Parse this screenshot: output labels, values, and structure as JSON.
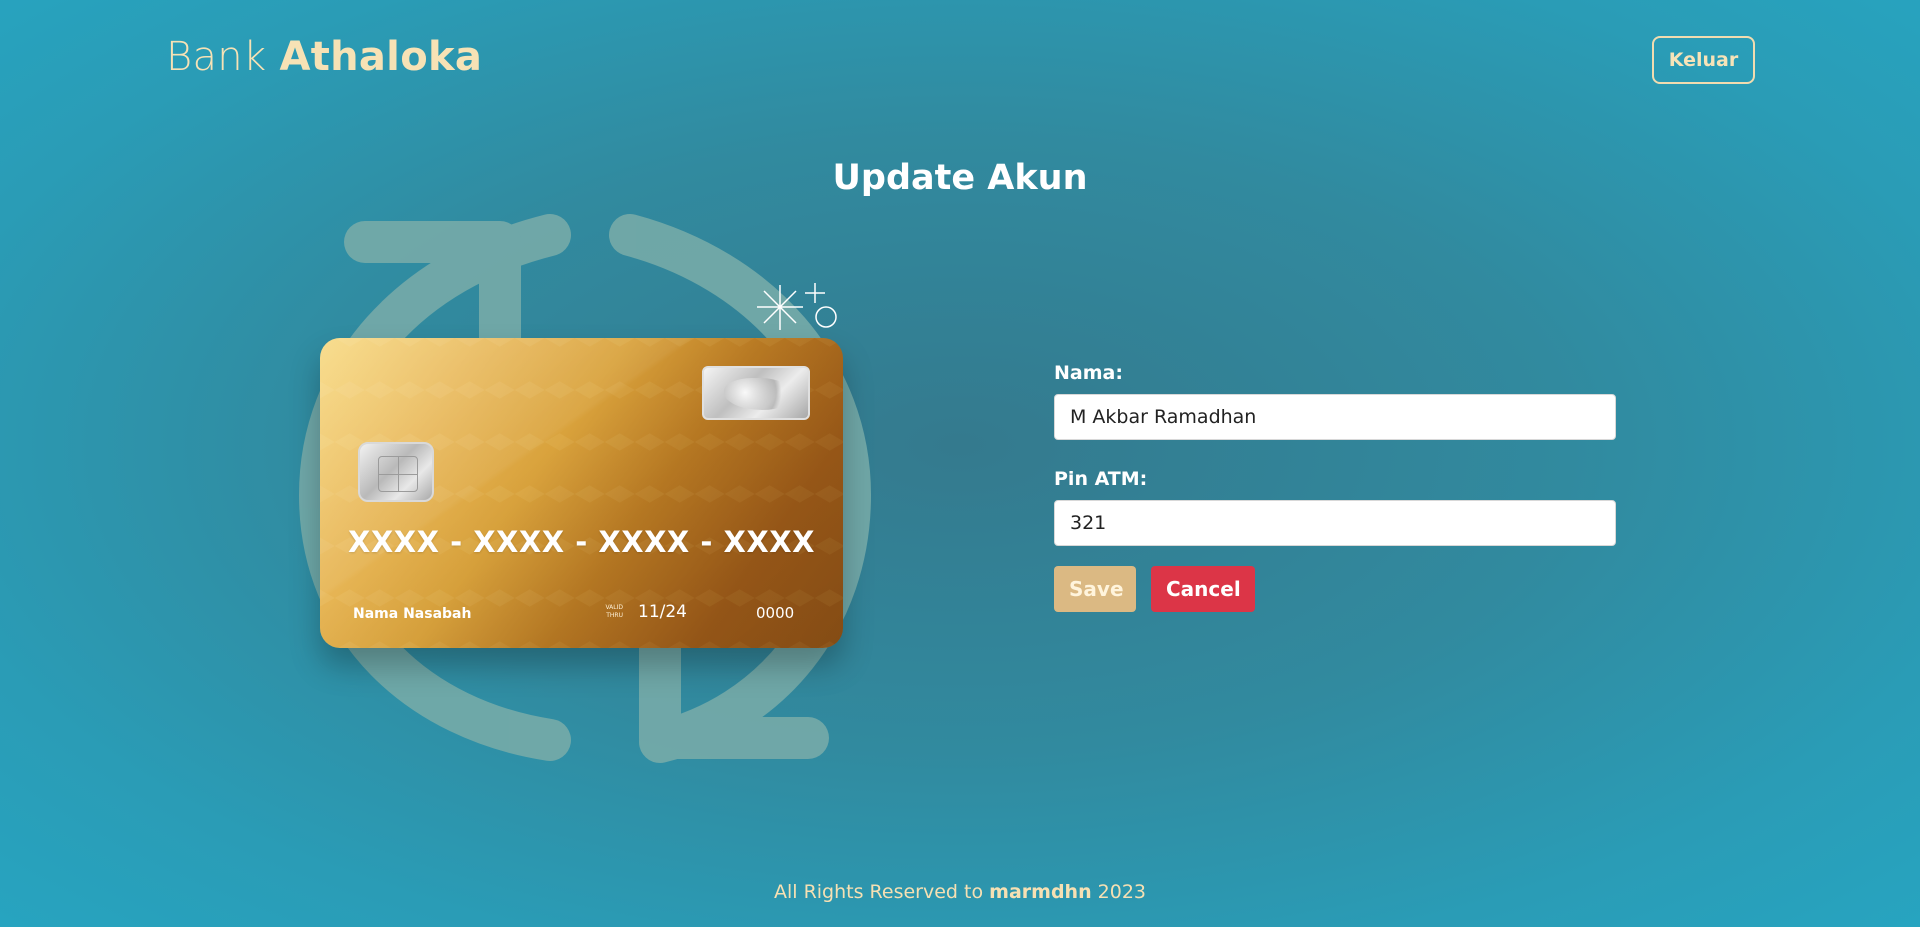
{
  "header": {
    "brand_prefix": "Bank",
    "brand_name": "Athaloka",
    "logout_label": "Keluar"
  },
  "main": {
    "title": "Update Akun",
    "card": {
      "number": "XXXX - XXXX - XXXX - XXXX",
      "holder": "Nama Nasabah",
      "valid_thru_line1": "VALID",
      "valid_thru_line2": "THRU",
      "expiry": "11/24",
      "cvv": "0000"
    },
    "form": {
      "name_label": "Nama:",
      "name_value": "M Akbar Ramadhan",
      "pin_label": "Pin ATM:",
      "pin_value": "321",
      "save_label": "Save",
      "cancel_label": "Cancel"
    }
  },
  "footer": {
    "prefix": "All Rights Reserved to",
    "author": "marmdhn",
    "year": "2023"
  },
  "colors": {
    "accent_cream": "#f7e2b5",
    "save": "#dbb983",
    "cancel": "#dc3547",
    "bg": "#318a9f"
  },
  "icons": [
    "refresh-arrows-icon",
    "sparkle-icon",
    "chip-icon",
    "hologram-icon"
  ]
}
